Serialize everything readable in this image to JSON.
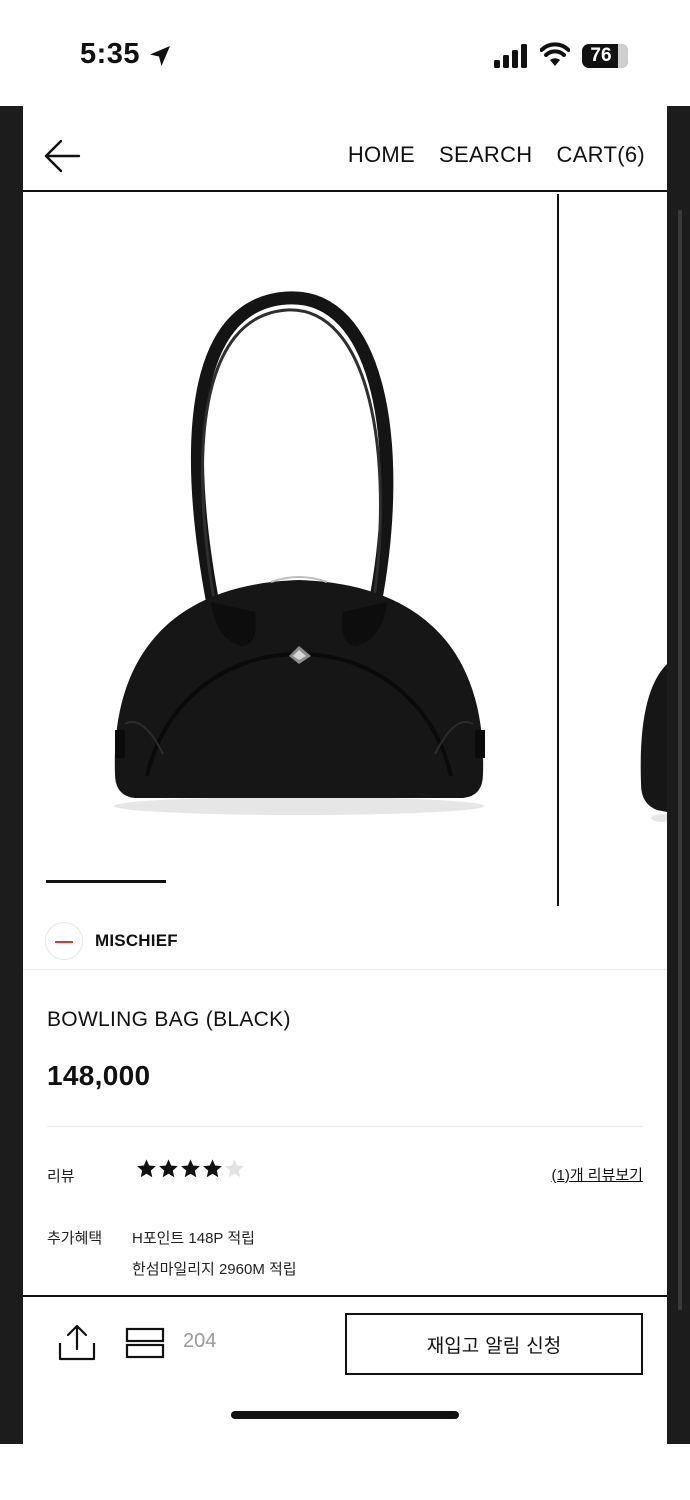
{
  "status_bar": {
    "time": "5:35",
    "battery": "76",
    "icons": [
      "location-arrow-icon",
      "signal-icon",
      "wifi-icon",
      "battery-icon"
    ]
  },
  "header": {
    "back_icon": "arrow-left-icon",
    "nav": {
      "home": "HOME",
      "search": "SEARCH",
      "cart": "CART(6)"
    }
  },
  "gallery": {
    "image": "black bowling bag",
    "current_slide": 1
  },
  "brand": {
    "name": "MISCHIEF"
  },
  "product": {
    "name": "BOWLING BAG (BLACK)",
    "price": "148,000"
  },
  "review": {
    "label": "리뷰",
    "rating": 4,
    "max_rating": 5,
    "link": "(1)개 리뷰보기"
  },
  "benefits": {
    "label": "추가혜택",
    "lines": [
      "H포인트 148P 적립",
      "한섬마일리지 2960M 적립"
    ]
  },
  "bottom_bar": {
    "share_icon": "share-icon",
    "bookmark_icon": "bookmark-icon",
    "like_count": "204",
    "restock_button": "재입고 알림 신청"
  },
  "colors": {
    "accent": "#111111",
    "muted": "#9a9a9a",
    "frame": "#1c1c1c"
  }
}
